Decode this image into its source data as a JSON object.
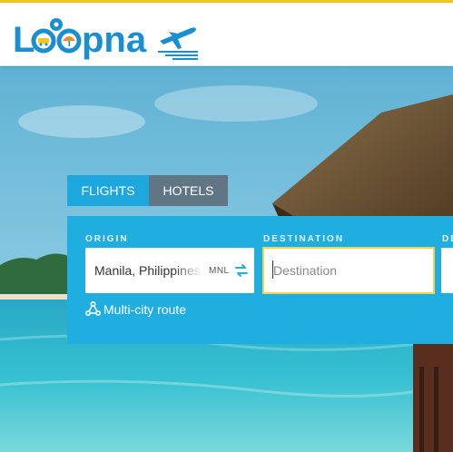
{
  "brand": {
    "name": "Loopna"
  },
  "tabs": [
    {
      "label": "FLIGHTS",
      "active": true
    },
    {
      "label": "HOTELS",
      "active": false
    }
  ],
  "search": {
    "origin_label": "ORIGIN",
    "origin_value": "Manila, Philippines",
    "origin_code": "MNL",
    "destination_label": "DESTINATION",
    "destination_placeholder": "Destination",
    "date_label": "DE",
    "multi_city_label": "Multi-city route"
  },
  "icons": {
    "swap": "swap-arrows-icon",
    "multi_city": "route-icon",
    "plane": "airplane-icon"
  },
  "colors": {
    "accent_yellow": "#f5c518",
    "panel_blue": "#20addf",
    "tab_active": "#1da7dd",
    "tab_inactive": "#5f707d",
    "logo_blue": "#1a8fd0"
  }
}
